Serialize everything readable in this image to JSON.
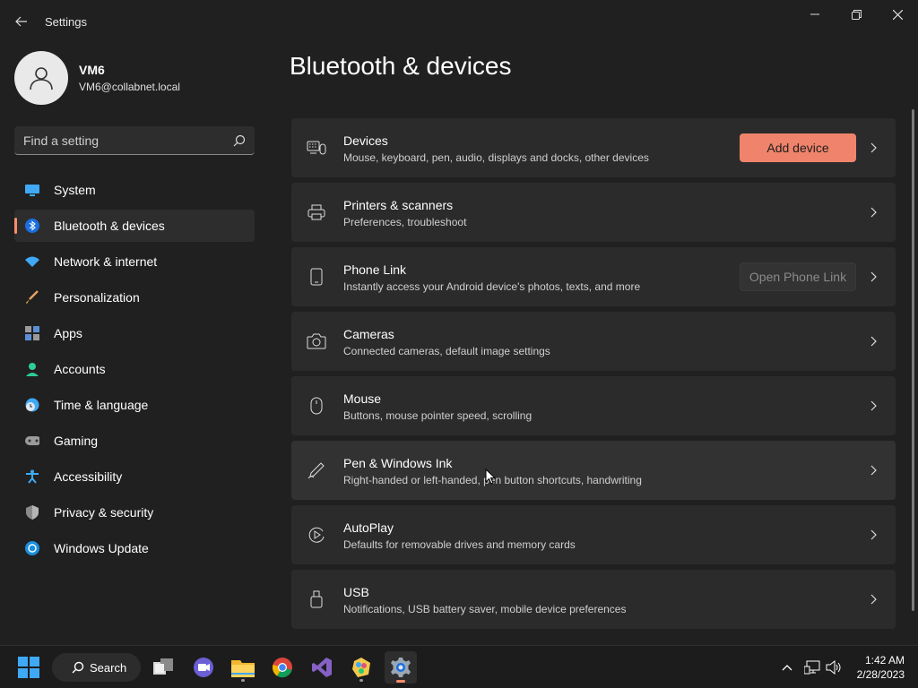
{
  "window": {
    "app_title": "Settings"
  },
  "profile": {
    "name": "VM6",
    "email": "VM6@collabnet.local"
  },
  "search": {
    "placeholder": "Find a setting"
  },
  "nav": {
    "items": [
      {
        "label": "System",
        "icon": "system-icon"
      },
      {
        "label": "Bluetooth & devices",
        "icon": "bluetooth-icon",
        "active": true
      },
      {
        "label": "Network & internet",
        "icon": "wifi-icon"
      },
      {
        "label": "Personalization",
        "icon": "brush-icon"
      },
      {
        "label": "Apps",
        "icon": "apps-icon"
      },
      {
        "label": "Accounts",
        "icon": "person-icon"
      },
      {
        "label": "Time & language",
        "icon": "clock-globe-icon"
      },
      {
        "label": "Gaming",
        "icon": "gamepad-icon"
      },
      {
        "label": "Accessibility",
        "icon": "accessibility-icon"
      },
      {
        "label": "Privacy & security",
        "icon": "shield-icon"
      },
      {
        "label": "Windows Update",
        "icon": "update-icon"
      }
    ]
  },
  "main": {
    "title": "Bluetooth & devices",
    "cards": [
      {
        "title": "Devices",
        "subtitle": "Mouse, keyboard, pen, audio, displays and docks, other devices",
        "icon": "devices-icon",
        "button": "Add device"
      },
      {
        "title": "Printers & scanners",
        "subtitle": "Preferences, troubleshoot",
        "icon": "printer-icon"
      },
      {
        "title": "Phone Link",
        "subtitle": "Instantly access your Android device's photos, texts, and more",
        "icon": "phone-icon",
        "button": "Open Phone Link"
      },
      {
        "title": "Cameras",
        "subtitle": "Connected cameras, default image settings",
        "icon": "camera-icon"
      },
      {
        "title": "Mouse",
        "subtitle": "Buttons, mouse pointer speed, scrolling",
        "icon": "mouse-icon"
      },
      {
        "title": "Pen & Windows Ink",
        "subtitle": "Right-handed or left-handed, pen button shortcuts, handwriting",
        "icon": "pen-icon"
      },
      {
        "title": "AutoPlay",
        "subtitle": "Defaults for removable drives and memory cards",
        "icon": "autoplay-icon"
      },
      {
        "title": "USB",
        "subtitle": "Notifications, USB battery saver, mobile device preferences",
        "icon": "usb-icon"
      }
    ]
  },
  "taskbar": {
    "search_label": "Search",
    "apps": [
      "start-icon",
      "task-view-icon",
      "meet-icon",
      "file-explorer-icon",
      "chrome-icon",
      "visual-studio-icon",
      "paint-icon",
      "settings-icon"
    ],
    "time": "1:42 AM",
    "date": "2/28/2023"
  },
  "colors": {
    "accent": "#f0836b",
    "background": "#202020",
    "card": "#2b2b2b"
  }
}
